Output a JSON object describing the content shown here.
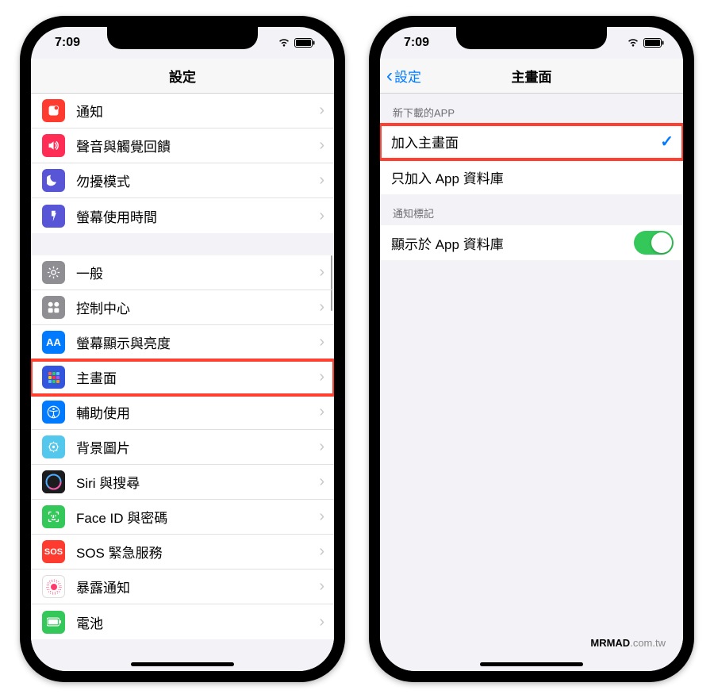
{
  "status": {
    "time": "7:09"
  },
  "left": {
    "title": "設定",
    "group1": [
      {
        "id": "notifications",
        "label": "通知",
        "bg": "#ff3b30"
      },
      {
        "id": "sounds",
        "label": "聲音與觸覺回饋",
        "bg": "#ff2d55"
      },
      {
        "id": "dnd",
        "label": "勿擾模式",
        "bg": "#5856d6"
      },
      {
        "id": "screentime",
        "label": "螢幕使用時間",
        "bg": "#5856d6"
      }
    ],
    "group2": [
      {
        "id": "general",
        "label": "一般",
        "bg": "#8e8e93"
      },
      {
        "id": "controlcenter",
        "label": "控制中心",
        "bg": "#8e8e93"
      },
      {
        "id": "display",
        "label": "螢幕顯示與亮度",
        "bg": "#007aff"
      },
      {
        "id": "homescreen",
        "label": "主畫面",
        "bg": "#3355dd",
        "highlight": true
      },
      {
        "id": "accessibility",
        "label": "輔助使用",
        "bg": "#007aff"
      },
      {
        "id": "wallpaper",
        "label": "背景圖片",
        "bg": "#54c7ec"
      },
      {
        "id": "siri",
        "label": "Siri 與搜尋",
        "bg": "#1c1c1e"
      },
      {
        "id": "faceid",
        "label": "Face ID 與密碼",
        "bg": "#34c759"
      },
      {
        "id": "sos",
        "label": "SOS 緊急服務",
        "bg": "#ff3b30"
      },
      {
        "id": "exposure",
        "label": "暴露通知",
        "bg": "#ffffff"
      },
      {
        "id": "battery",
        "label": "電池",
        "bg": "#34c759"
      }
    ]
  },
  "right": {
    "back_label": "設定",
    "title": "主畫面",
    "section1_header": "新下載的APP",
    "options": [
      {
        "id": "add-home",
        "label": "加入主畫面",
        "checked": true,
        "highlight": true
      },
      {
        "id": "app-library",
        "label": "只加入 App 資料庫",
        "checked": false
      }
    ],
    "section2_header": "通知標記",
    "toggle_row": {
      "id": "show-badges",
      "label": "顯示於 App 資料庫",
      "on": true
    },
    "watermark_bold": "MRMAD",
    "watermark_rest": ".com.tw"
  }
}
